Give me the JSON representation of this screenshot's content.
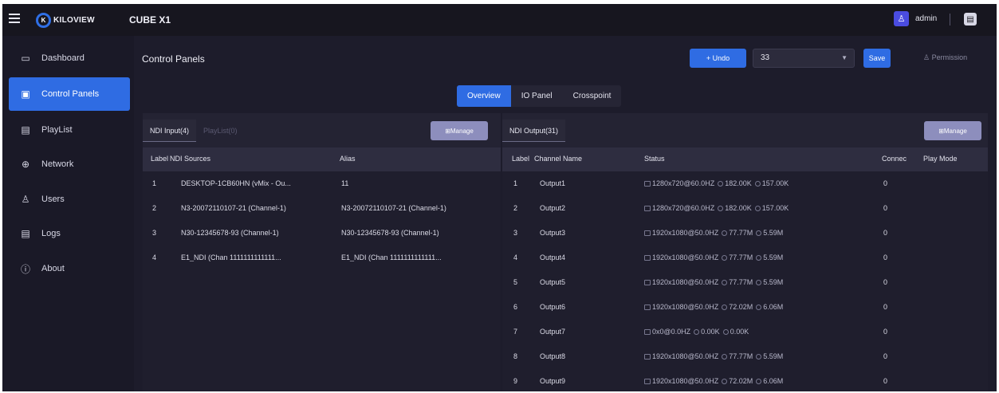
{
  "topbar": {
    "logo_text": "KILOVIEW",
    "device": "CUBE X1",
    "user": "admin",
    "icons": [
      "menu-icon",
      "user-avatar-icon",
      "notification-icon"
    ]
  },
  "sidebar": {
    "items": [
      {
        "label": "Dashboard",
        "icon": "dashboard-icon",
        "glyph": "▭"
      },
      {
        "label": "Control Panels",
        "icon": "control-panels-icon",
        "glyph": "▣",
        "active": true
      },
      {
        "label": "PlayList",
        "icon": "playlist-icon",
        "glyph": "▤"
      },
      {
        "label": "Network",
        "icon": "globe-icon",
        "glyph": "⊕"
      },
      {
        "label": "Users",
        "icon": "users-icon",
        "glyph": "♙"
      },
      {
        "label": "Logs",
        "icon": "logs-icon",
        "glyph": "▤"
      },
      {
        "label": "About",
        "icon": "info-icon",
        "glyph": "ⓘ"
      }
    ]
  },
  "header": {
    "title": "Control Panels",
    "undo_label": "+ Undo",
    "select_value": "33",
    "save_label": "Save",
    "permission_label": "Permission"
  },
  "tabs": [
    {
      "label": "Overview",
      "active": true
    },
    {
      "label": "IO Panel",
      "active": false
    },
    {
      "label": "Crosspoint",
      "active": false
    }
  ],
  "left_panel": {
    "tab_active": "NDI Input(4)",
    "tab_inactive": "PlayList(0)",
    "manage_label": "Manage",
    "columns": [
      "Label",
      "NDI Sources",
      "Alias"
    ],
    "rows": [
      [
        "1",
        "DESKTOP-1CB60HN (vMix - Ou...",
        "11"
      ],
      [
        "2",
        "N3-20072110107-21 (Channel-1)",
        "N3-20072110107-21 (Channel-1)"
      ],
      [
        "3",
        "N30-12345678-93 (Channel-1)",
        "N30-12345678-93 (Channel-1)"
      ],
      [
        "4",
        "E1_NDI (Chan 1111111111111...",
        "E1_NDI (Chan 1111111111111..."
      ]
    ]
  },
  "right_panel": {
    "tab_active": "NDI Output(31)",
    "manage_label": "Manage",
    "columns": [
      "Label",
      "Channel Name",
      "Status",
      "Connec",
      "Play Mode"
    ],
    "rows": [
      {
        "label": "1",
        "name": "Output1",
        "res": "1280x720@60.0HZ",
        "a": "182.00K",
        "b": "157.00K",
        "conn": "0"
      },
      {
        "label": "2",
        "name": "Output2",
        "res": "1280x720@60.0HZ",
        "a": "182.00K",
        "b": "157.00K",
        "conn": "0"
      },
      {
        "label": "3",
        "name": "Output3",
        "res": "1920x1080@50.0HZ",
        "a": "77.77M",
        "b": "5.59M",
        "conn": "0"
      },
      {
        "label": "4",
        "name": "Output4",
        "res": "1920x1080@50.0HZ",
        "a": "77.77M",
        "b": "5.59M",
        "conn": "0"
      },
      {
        "label": "5",
        "name": "Output5",
        "res": "1920x1080@50.0HZ",
        "a": "77.77M",
        "b": "5.59M",
        "conn": "0"
      },
      {
        "label": "6",
        "name": "Output6",
        "res": "1920x1080@50.0HZ",
        "a": "72.02M",
        "b": "6.06M",
        "conn": "0"
      },
      {
        "label": "7",
        "name": "Output7",
        "res": "0x0@0.0HZ",
        "a": "0.00K",
        "b": "0.00K",
        "conn": "0"
      },
      {
        "label": "8",
        "name": "Output8",
        "res": "1920x1080@50.0HZ",
        "a": "77.77M",
        "b": "5.59M",
        "conn": "0"
      },
      {
        "label": "9",
        "name": "Output9",
        "res": "1920x1080@50.0HZ",
        "a": "72.02M",
        "b": "6.06M",
        "conn": "0"
      }
    ]
  },
  "colors": {
    "accent": "#2f6ce3",
    "background": "#1d1c2b",
    "manage": "#8d8ebd"
  }
}
